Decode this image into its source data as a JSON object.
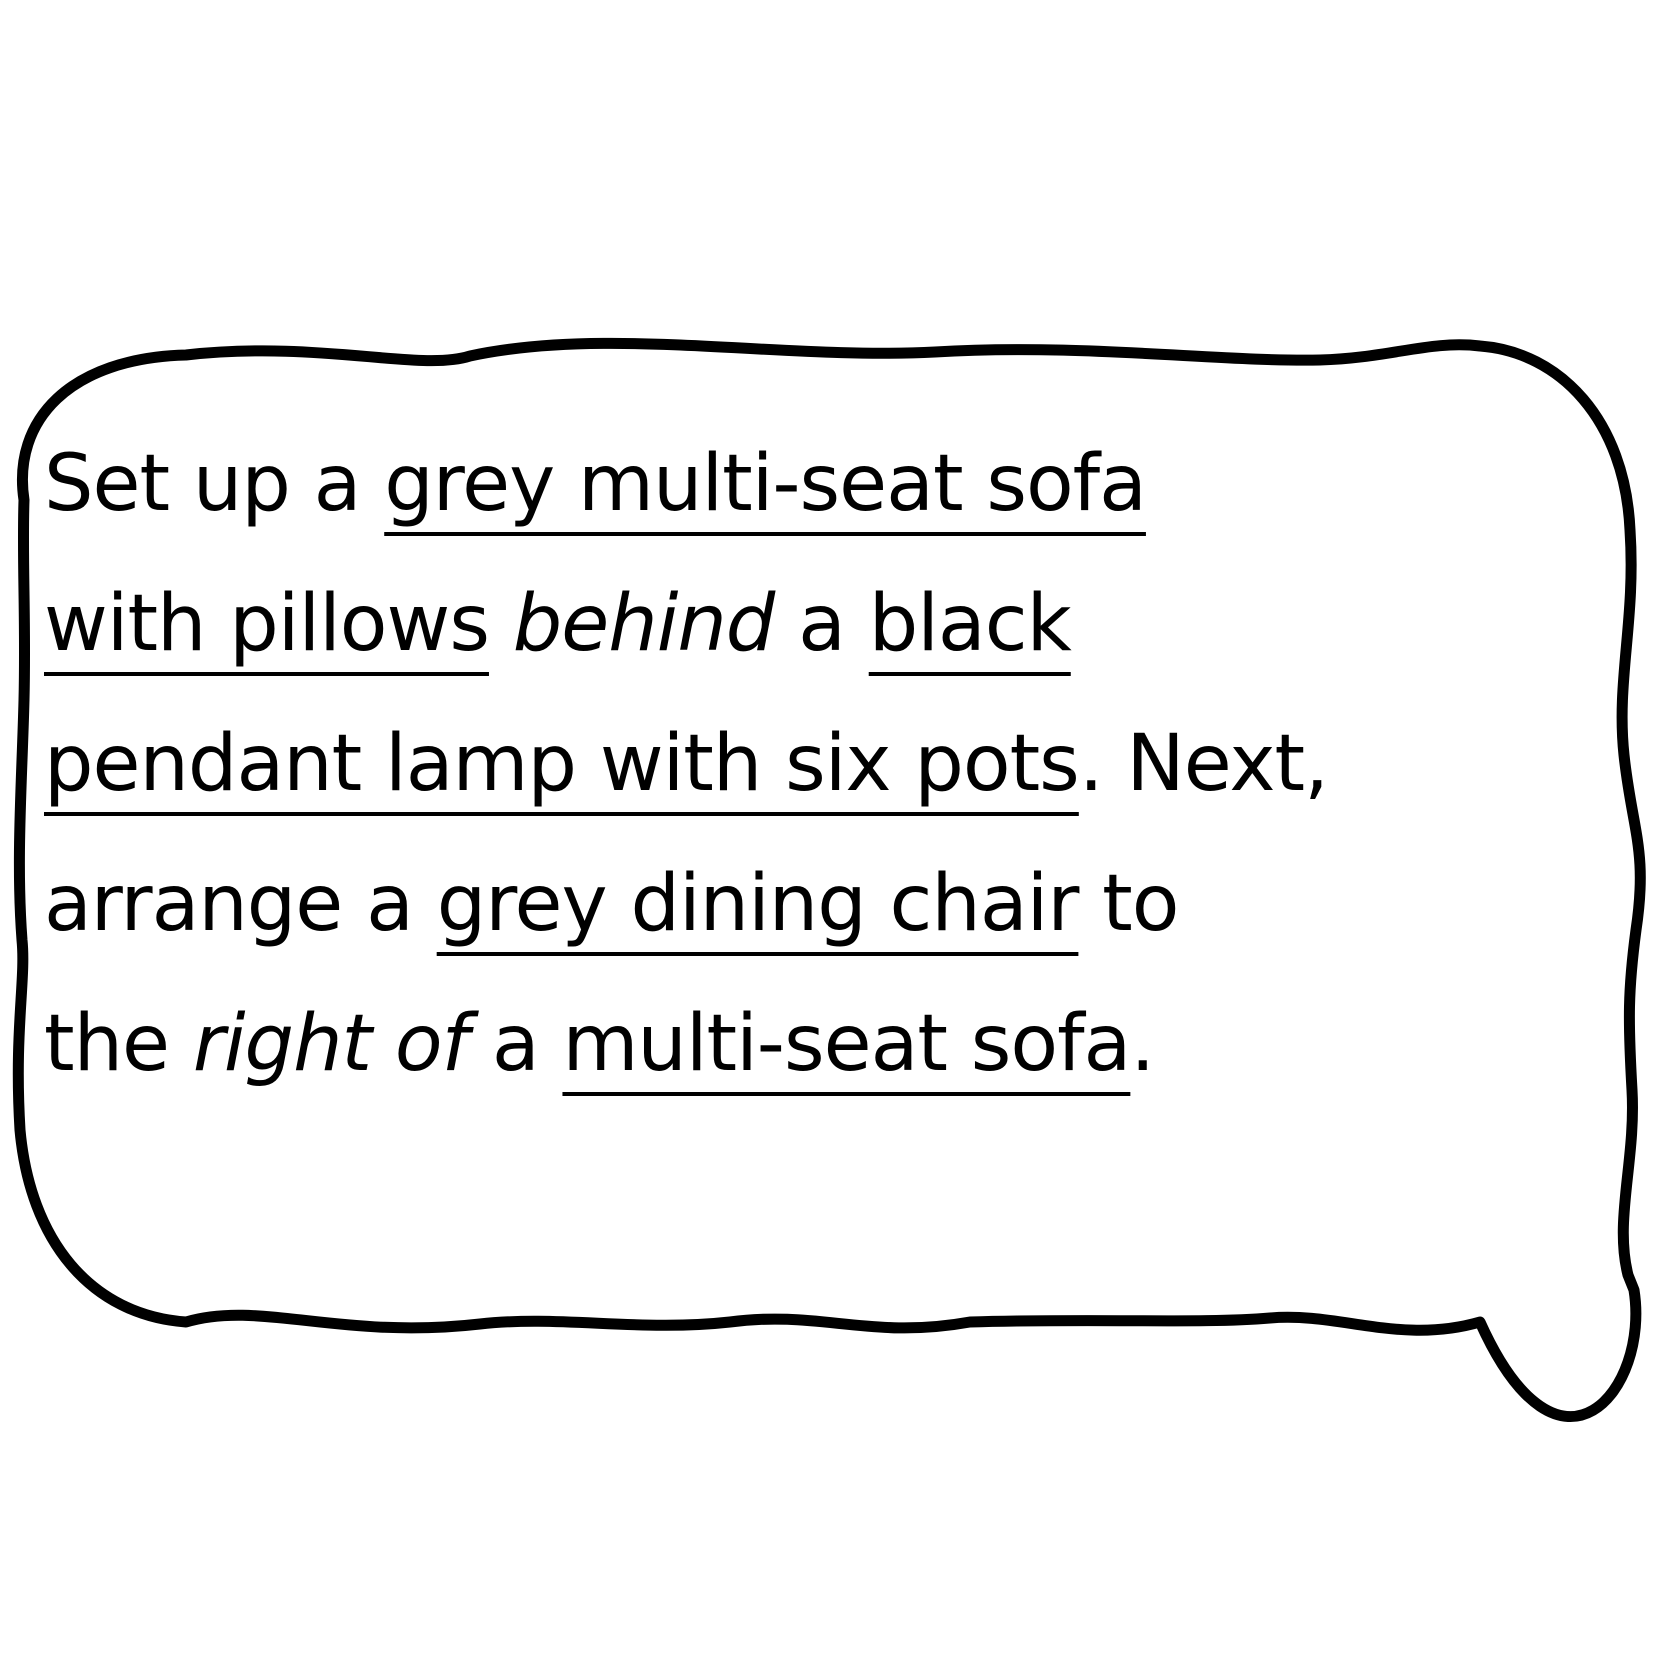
{
  "colors": {
    "background": "#ffffff",
    "ink": "#000000"
  },
  "caption": {
    "line1": {
      "t1": "Set up a ",
      "t2": "grey multi-seat sofa"
    },
    "line2": {
      "t1": "with pillows",
      "t2": " ",
      "t3": "behind",
      "t4": " a ",
      "t5": "black"
    },
    "line3": {
      "t1": "pendant lamp with six pots",
      "t2": ". Next,"
    },
    "line4": {
      "t1": "arrange a ",
      "t2": "grey dining chair",
      "t3": " to"
    },
    "line5": {
      "t1": "the ",
      "t2": "right of",
      "t3": " a ",
      "t4": "multi-seat sofa",
      "t5": "."
    }
  }
}
